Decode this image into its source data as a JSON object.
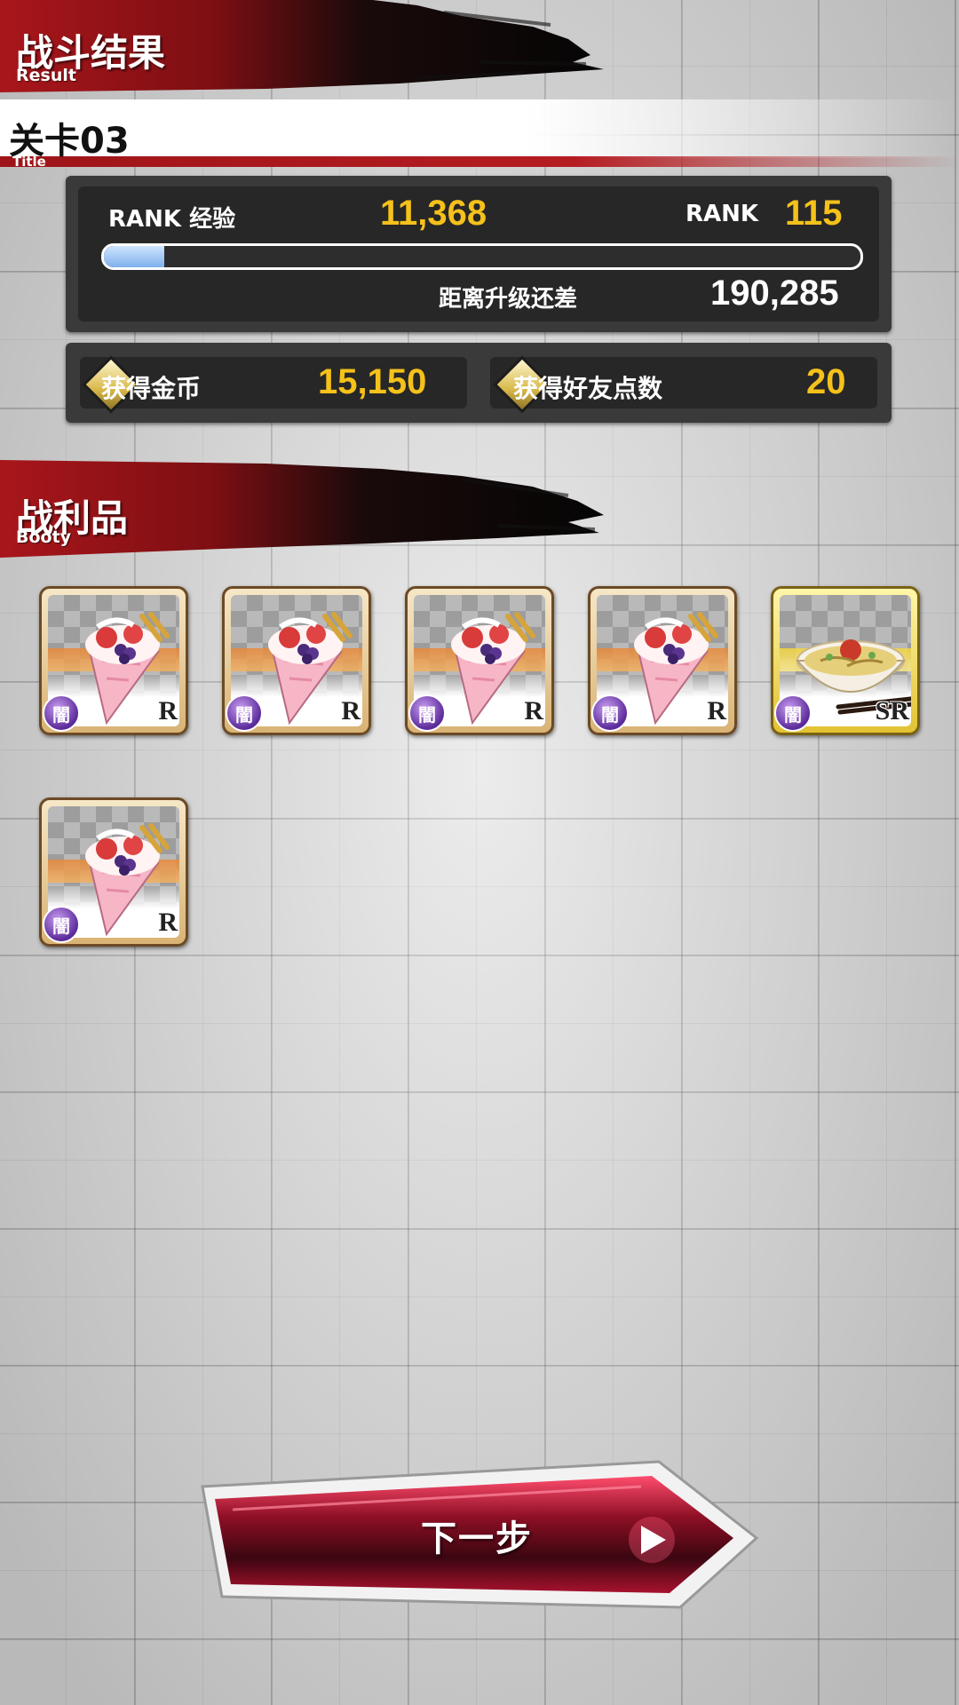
{
  "result_header": {
    "title": "战斗结果",
    "subtitle": "Result"
  },
  "stage": {
    "name": "关卡03",
    "sub": "Title"
  },
  "rank_panel": {
    "exp_label": "RANK 经验",
    "exp_value": "11,368",
    "rank_label": "RANK",
    "rank_value": "115",
    "progress_fraction": 0.08,
    "remaining_label": "距离升级还差",
    "remaining_value": "190,285"
  },
  "rewards": {
    "gold_label": "获得金币",
    "gold_value": "15,150",
    "friend_label": "获得好友点数",
    "friend_value": "20"
  },
  "booty_header": {
    "title": "战利品",
    "subtitle": "Booty"
  },
  "items": [
    {
      "icon": "crepe-icon",
      "rarity": "R",
      "element": "闇"
    },
    {
      "icon": "crepe-icon",
      "rarity": "R",
      "element": "闇"
    },
    {
      "icon": "crepe-icon",
      "rarity": "R",
      "element": "闇"
    },
    {
      "icon": "crepe-icon",
      "rarity": "R",
      "element": "闇"
    },
    {
      "icon": "ramen-bowl-icon",
      "rarity": "SR",
      "element": "闇"
    },
    {
      "icon": "crepe-icon",
      "rarity": "R",
      "element": "闇"
    }
  ],
  "next_button": {
    "label": "下一步"
  },
  "colors": {
    "accent_red": "#9e1418",
    "value_gold": "#f5c11a",
    "panel": "#3a3a3a"
  }
}
